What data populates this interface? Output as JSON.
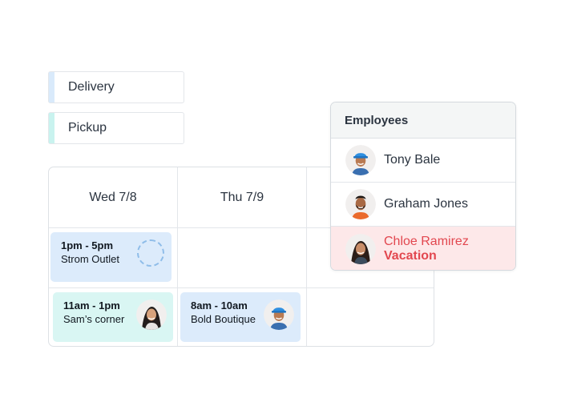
{
  "legend": [
    {
      "label": "Delivery",
      "color": "#d9eafb"
    },
    {
      "label": "Pickup",
      "color": "#c9f3ef"
    }
  ],
  "schedule": {
    "columns": [
      "Wed 7/8",
      "Thu 7/9",
      ""
    ],
    "shifts": [
      {
        "time": "1pm - 5pm",
        "place": "Strom Outlet",
        "type": "Delivery",
        "assignee": "open"
      },
      {
        "time": "11am - 1pm",
        "place": "Sam’s corner",
        "type": "Pickup",
        "assignee": "Chloe Ramirez"
      },
      {
        "time": "8am - 10am",
        "place": "Bold Boutique",
        "type": "Delivery",
        "assignee": "Tony Bale"
      }
    ]
  },
  "employees_panel": {
    "title": "Employees",
    "employees": [
      {
        "name": "Tony Bale",
        "status": ""
      },
      {
        "name": "Graham Jones",
        "status": ""
      },
      {
        "name": "Chloe Ramirez",
        "status": "Vacation"
      }
    ]
  },
  "colors": {
    "delivery_shift": "#dcebfb",
    "pickup_shift": "#d9f6f3",
    "vacation_bg": "#fde8e9",
    "vacation_text": "#e2474f"
  }
}
